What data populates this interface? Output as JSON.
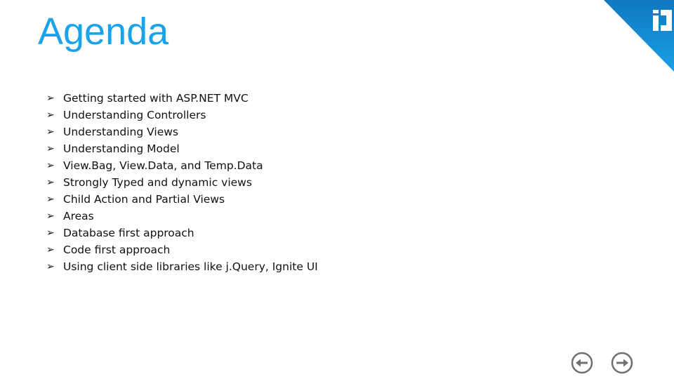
{
  "slide": {
    "title": "Agenda",
    "brand_color": "#1aa3e8",
    "logo_icon": "ig-logo-icon",
    "items": [
      "Getting started with ASP.NET MVC",
      "Understanding Controllers",
      "Understanding Views",
      "Understanding Model",
      "View.Bag, View.Data, and Temp.Data",
      "Strongly Typed and dynamic views",
      "Child Action and Partial Views",
      "Areas",
      "Database first approach",
      "Code first approach",
      "Using client side libraries like j.Query, Ignite UI"
    ],
    "bullet_glyph": "➢"
  },
  "navigation": {
    "prev_icon": "arrow-left-circle-icon",
    "next_icon": "arrow-right-circle-icon"
  }
}
